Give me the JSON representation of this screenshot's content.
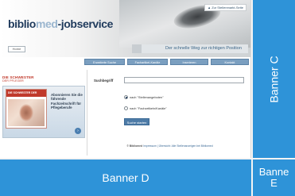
{
  "site": {
    "top_link": "▲ Zur Stellenmarkt-Seite",
    "logo": {
      "part1": "biblio",
      "part2": "med",
      "part3": "-jobservice"
    },
    "search_mini_label": "Home",
    "slogan": "Der schnelle Weg zur richtigen Position"
  },
  "nav": {
    "tabs": [
      "Erweiterte Suche",
      "Fachartikel-Kanäle",
      "Inserieren",
      "Kontakt"
    ]
  },
  "sidebar": {
    "ad_title": "DIE SCHWESTER",
    "ad_subtitle": "DER PFLEGER",
    "ad_mag_header": "DIE SCHWESTER DER PFLEGER",
    "ad_text": "Abonnieren Sie die führende Fachzeitschrift für Pflegeberufe",
    "ad_arrow": "›"
  },
  "form": {
    "label": "Suchbegriff",
    "input_value": "",
    "radio_options": [
      {
        "label": "nach \"Stellenangeboten\"",
        "checked": true
      },
      {
        "label": "nach \"Fachartikeln/Kanäle\"",
        "checked": false
      }
    ],
    "submit_label": "Suche starten",
    "footer_prefix": "© Bibliomed",
    "footer_links": "Impressum | Übersicht: Alle Stellenanzeigen bei Bibliomed"
  },
  "banners": {
    "c": "Banner C",
    "d": "Banner D",
    "e_line1": "Banne",
    "e_line2": "E"
  },
  "colors": {
    "banner_blue": "#2e93d8",
    "nav_blue": "#7b9fc0",
    "logo_dark": "#1f3a5c",
    "logo_light": "#9bb6cf",
    "ad_red": "#c0392b"
  }
}
